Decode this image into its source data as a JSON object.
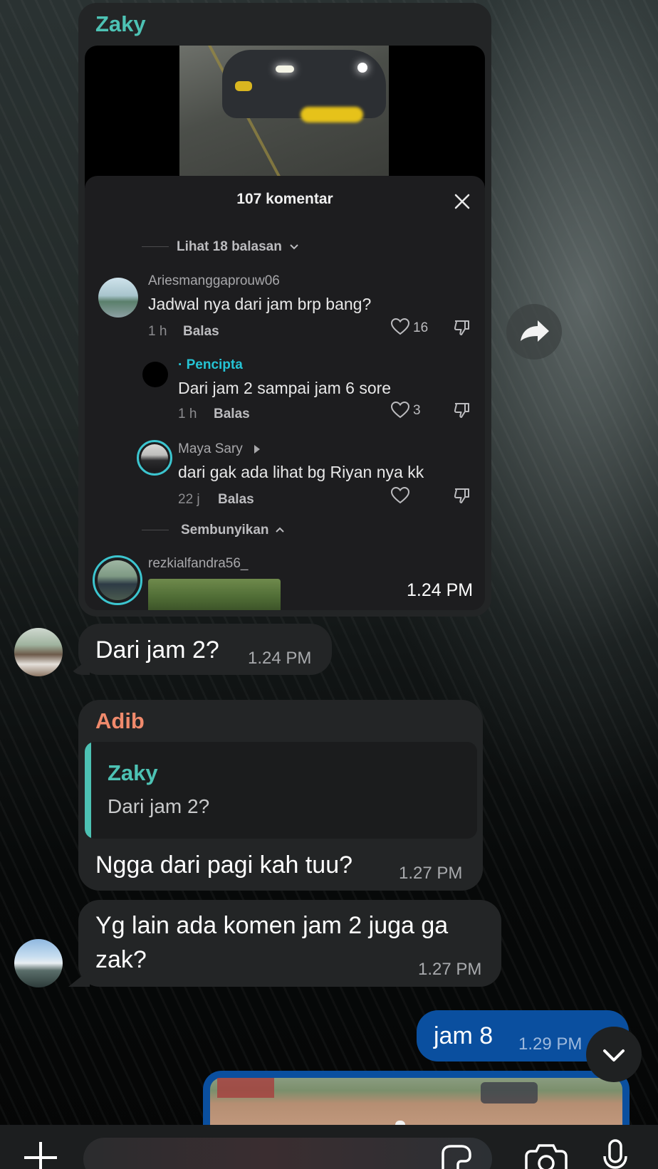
{
  "colors": {
    "incoming_bubble": "#232526",
    "outgoing_bubble": "#0a4f9f",
    "sender_zaky": "#4dc2b4",
    "sender_adib": "#f08a6c",
    "tiktok_creator": "#25c3d4"
  },
  "messages": {
    "tiktok_share": {
      "sender": "Zaky",
      "time": "1.24 PM",
      "tiktok": {
        "comment_count_title": "107 komentar",
        "view_replies": "Lihat 18 balasan",
        "hide_label": "Sembunyikan",
        "comments": [
          {
            "username": "Ariesmanggaprouw06",
            "text": "Jadwal nya dari jam brp bang?",
            "age": "1 h",
            "reply_label": "Balas",
            "likes": "16"
          },
          {
            "username": "· Pencipta",
            "text": "Dari jam 2 sampai jam 6 sore",
            "age": "1 h",
            "reply_label": "Balas",
            "likes": "3"
          },
          {
            "username": "Maya Sary",
            "text": "dari gak ada lihat bg Riyan nya kk",
            "age": "22 j",
            "reply_label": "Balas",
            "likes": ""
          },
          {
            "username": "rezkialfandra56_"
          }
        ]
      }
    },
    "msg2": {
      "text": "Dari jam 2?",
      "time": "1.24 PM"
    },
    "msg3": {
      "sender": "Adib",
      "quote_sender": "Zaky",
      "quote_text": "Dari jam 2?",
      "text": "Ngga dari pagi kah tuu?",
      "time": "1.27 PM"
    },
    "msg4": {
      "text_line1": "Yg lain ada komen jam 2 juga ga",
      "text_line2": "zak?",
      "time": "1.27 PM"
    },
    "msg5": {
      "text": "jam 8",
      "time": "1.29 PM"
    }
  },
  "icons": {
    "share": "share-arrow-icon",
    "scroll_down": "chevron-down-icon",
    "attach": "plus-icon",
    "sticker": "sticker-icon",
    "camera": "camera-icon",
    "mic": "microphone-icon"
  }
}
